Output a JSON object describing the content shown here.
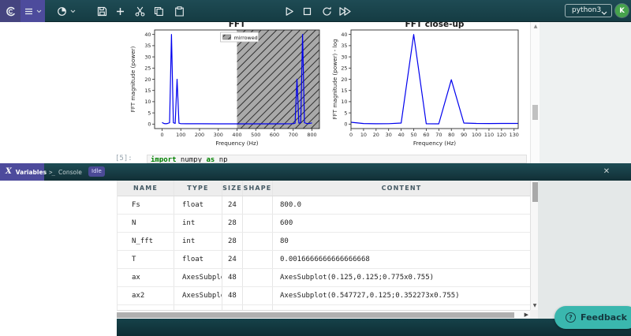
{
  "toolbar": {
    "kernel_selector": "python3",
    "avatar_initial": "K",
    "icon_names": [
      "app-logo",
      "main-menu",
      "chevron-down",
      "kernel-pie",
      "save",
      "insert-cell-below",
      "cut-cells",
      "copy-cells",
      "paste-cells",
      "run-cell",
      "interrupt-kernel",
      "restart-kernel",
      "run-all-cells"
    ]
  },
  "notebook": {
    "cell_prompt": "[5]:",
    "code_tokens": [
      {
        "text": "import",
        "type": "kw"
      },
      {
        "text": " numpy ",
        "type": "plain"
      },
      {
        "text": "as",
        "type": "kw"
      },
      {
        "text": " np",
        "type": "plain"
      }
    ]
  },
  "chart_data": [
    {
      "type": "line",
      "title": "FFT",
      "xlabel": "Frequency (Hz)",
      "ylabel": "FFT magnitude (power)",
      "xlim": [
        -40,
        840
      ],
      "ylim": [
        -2,
        42
      ],
      "xticks": [
        0,
        100,
        200,
        300,
        400,
        500,
        600,
        700,
        800
      ],
      "yticks": [
        0,
        5,
        10,
        15,
        20,
        25,
        30,
        35,
        40
      ],
      "grid": false,
      "legend": {
        "visible": true,
        "label": "mirrowed",
        "position": "upper center"
      },
      "span": {
        "from": 400,
        "to": 840,
        "style": "gray-hatched"
      },
      "series": [
        {
          "name": "fft-power",
          "color": "#0000ee",
          "points": [
            [
              0,
              0.7
            ],
            [
              10,
              0.25
            ],
            [
              20,
              0.15
            ],
            [
              30,
              0.3
            ],
            [
              40,
              0.6
            ],
            [
              50,
              40
            ],
            [
              60,
              0.6
            ],
            [
              70,
              0.3
            ],
            [
              80,
              20
            ],
            [
              90,
              0.4
            ],
            [
              100,
              0.2
            ],
            [
              130,
              0.15
            ],
            [
              200,
              0.15
            ],
            [
              300,
              0.12
            ],
            [
              400,
              0.12
            ],
            [
              500,
              0.12
            ],
            [
              600,
              0.12
            ],
            [
              690,
              0.15
            ],
            [
              700,
              0.2
            ],
            [
              710,
              0.4
            ],
            [
              720,
              20
            ],
            [
              730,
              0.4
            ],
            [
              740,
              0.6
            ],
            [
              750,
              40
            ],
            [
              760,
              0.6
            ],
            [
              770,
              0.3
            ],
            [
              780,
              0.2
            ],
            [
              800,
              0.5
            ]
          ]
        }
      ]
    },
    {
      "type": "line",
      "title": "FFT close-up",
      "xlabel": "Frequency (Hz)",
      "ylabel": "FFT magnitude (power) - log",
      "xlim": [
        0,
        133.3
      ],
      "ylim": [
        -2,
        42
      ],
      "xticks": [
        0,
        10,
        20,
        30,
        40,
        50,
        60,
        70,
        80,
        90,
        100,
        110,
        120,
        130
      ],
      "yticks": [
        0,
        5,
        10,
        15,
        20,
        25,
        30,
        35,
        40
      ],
      "grid": false,
      "legend": {
        "visible": false
      },
      "span": null,
      "series": [
        {
          "name": "fft-closeup",
          "color": "#0000ee",
          "points": [
            [
              0,
              0.8
            ],
            [
              10,
              0.25
            ],
            [
              20,
              0.15
            ],
            [
              30,
              0.2
            ],
            [
              40,
              0.45
            ],
            [
              50,
              40
            ],
            [
              60,
              0.15
            ],
            [
              70,
              0.1
            ],
            [
              80,
              19.8
            ],
            [
              90,
              0.45
            ],
            [
              100,
              0.3
            ],
            [
              110,
              0.25
            ],
            [
              120,
              0.3
            ],
            [
              130,
              0.3
            ],
            [
              133.3,
              0.3
            ]
          ]
        }
      ]
    }
  ],
  "panel": {
    "tabs": [
      {
        "label": "Variables",
        "icon": "variables-x-icon",
        "active": true
      },
      {
        "label": "Console",
        "icon": "console-prompt-icon",
        "active": false
      }
    ],
    "status_badge": "Idle",
    "close_icon": "✕",
    "table": {
      "headers": [
        "NAME",
        "TYPE",
        "SIZE",
        "SHAPE",
        "CONTENT"
      ],
      "rows": [
        [
          "Fs",
          "float",
          "24",
          "",
          "800.0"
        ],
        [
          "N",
          "int",
          "28",
          "",
          "600"
        ],
        [
          "N_fft",
          "int",
          "28",
          "",
          "80"
        ],
        [
          "T",
          "float",
          "24",
          "",
          "0.0016666666666666668"
        ],
        [
          "ax",
          "AxesSubplot",
          "48",
          "",
          "AxesSubplot(0.125,0.125;0.775x0.755)"
        ],
        [
          "ax2",
          "AxesSubplot",
          "48",
          "",
          "AxesSubplot(0.547727,0.125;0.352273x0.755)"
        ]
      ]
    }
  },
  "feedback": {
    "label": "Feedback"
  },
  "colors": {
    "toolbar_teal": "#17424a",
    "accent_purple": "#4d4b9c",
    "line_blue": "#0000ee",
    "span_gray": "#9a9a9a",
    "feedback_teal": "#3ab7ae",
    "avatar_green": "#46a34c"
  }
}
